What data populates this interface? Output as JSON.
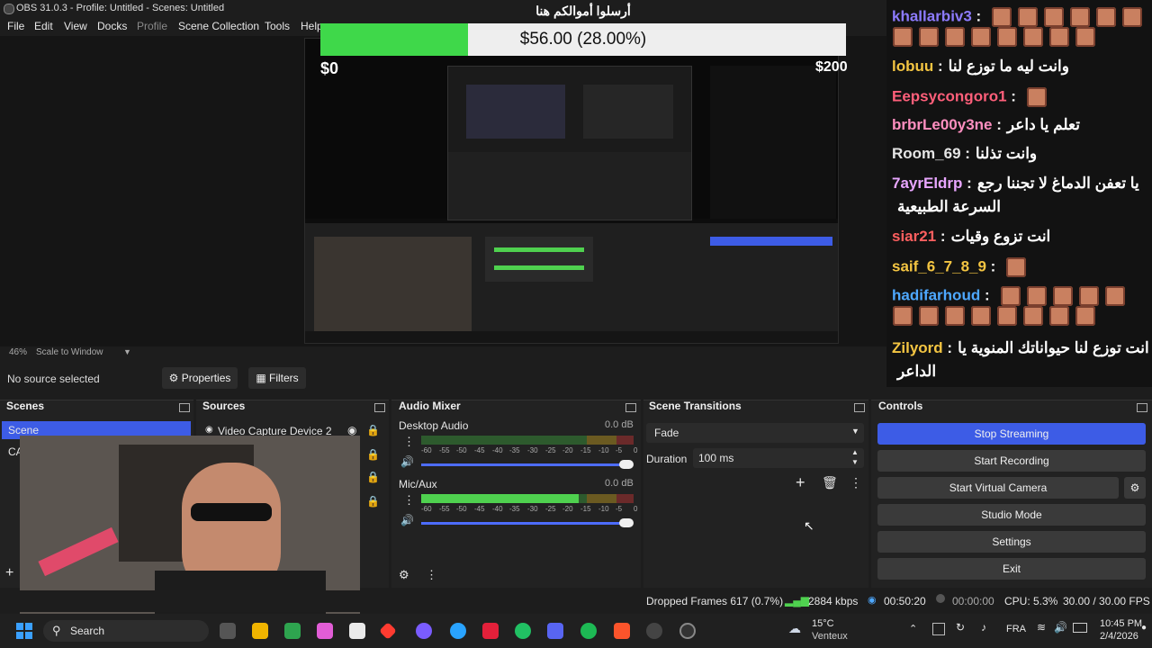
{
  "window": {
    "title": "OBS 31.0.3 - Profile: Untitled - Scenes: Untitled"
  },
  "menu": [
    "File",
    "Edit",
    "View",
    "Docks",
    "Profile",
    "Scene Collection",
    "Tools",
    "Help"
  ],
  "overlay": {
    "banner": "أرسلوا أموالكم هنا",
    "donation_text": "$56.00 (28.00%)",
    "min_label": "$0",
    "max_label": "$200",
    "progress_fraction": 0.28
  },
  "chat": [
    {
      "user": "khallarbiv3",
      "sep": " :",
      "text": "",
      "color": "#8d7bff"
    },
    {
      "user": "lobuu",
      "sep": " :",
      "text": "وانت ليه ما توزع لنا",
      "color": "#f4c542"
    },
    {
      "user": "Eepsycongoro1",
      "sep": " :",
      "text": "",
      "color": "#ff5f7a"
    },
    {
      "user": "brbrLe00y3ne",
      "sep": " :",
      "text": "تعلم يا داعر",
      "color": "#ff8fc0"
    },
    {
      "user": "Room_69",
      "sep": " :",
      "text": "وانت تذلنا",
      "color": "#e6e6e6"
    },
    {
      "user": "7ayrEldrp",
      "sep": " :",
      "text": "يا تعفن الدماغ لا تجننا رجع",
      "color": "#e8a6ff"
    },
    {
      "user": "",
      "sep": "",
      "text": "السرعة الطبيعية",
      "color": "#ffffff"
    },
    {
      "user": "siar21",
      "sep": " :",
      "text": "انت تزوع وقيات",
      "color": "#ff5f5f"
    },
    {
      "user": "saif_6_7_8_9",
      "sep": " :",
      "text": "",
      "color": "#f4c542"
    },
    {
      "user": "hadifarhoud",
      "sep": " :",
      "text": "",
      "color": "#4ea8ff"
    },
    {
      "user": "Zilyord",
      "sep": " :",
      "text": "انت توزع لنا حيواناتك المنوية يا",
      "color": "#f4c542"
    },
    {
      "user": "",
      "sep": "",
      "text": "الداعر",
      "color": "#ffffff"
    }
  ],
  "preview": {
    "zoom": "46%",
    "scale_mode": "Scale to Window"
  },
  "source_bar": {
    "status": "No source selected",
    "properties": "Properties",
    "filters": "Filters"
  },
  "scenes": {
    "title": "Scenes",
    "items": [
      "Scene",
      "CA"
    ]
  },
  "sources": {
    "title": "Sources",
    "items": [
      "Video Capture Device 2"
    ]
  },
  "mixer": {
    "title": "Audio Mixer",
    "channels": [
      {
        "name": "Desktop Audio",
        "db": "0.0 dB",
        "level": 0.0
      },
      {
        "name": "Mic/Aux",
        "db": "0.0 dB",
        "level": 0.74
      }
    ],
    "ticks": [
      "-60",
      "-55",
      "-50",
      "-45",
      "-40",
      "-35",
      "-30",
      "-25",
      "-20",
      "-15",
      "-10",
      "-5",
      "0"
    ]
  },
  "transitions": {
    "title": "Scene Transitions",
    "selected": "Fade",
    "duration_label": "Duration",
    "duration": "100 ms"
  },
  "controls": {
    "title": "Controls",
    "buttons": [
      "Stop Streaming",
      "Start Recording",
      "Start Virtual Camera",
      "Studio Mode",
      "Settings",
      "Exit"
    ]
  },
  "status": {
    "dropped": "Dropped Frames 617 (0.7%)",
    "bitrate": "2884 kbps",
    "stream_time": "00:50:20",
    "rec_time": "00:00:00",
    "cpu": "CPU: 5.3%",
    "fps": "30.00 / 30.00 FPS"
  },
  "taskbar": {
    "search": "Search",
    "weather_temp": "15°C",
    "weather_desc": "Venteux",
    "lang": "FRA",
    "time": "10:45 PM",
    "date": "2/4/2026"
  },
  "colors": {
    "accent": "#3d5ce6",
    "meter_green": "#4fd14f",
    "progress_green": "#3fd84a"
  }
}
